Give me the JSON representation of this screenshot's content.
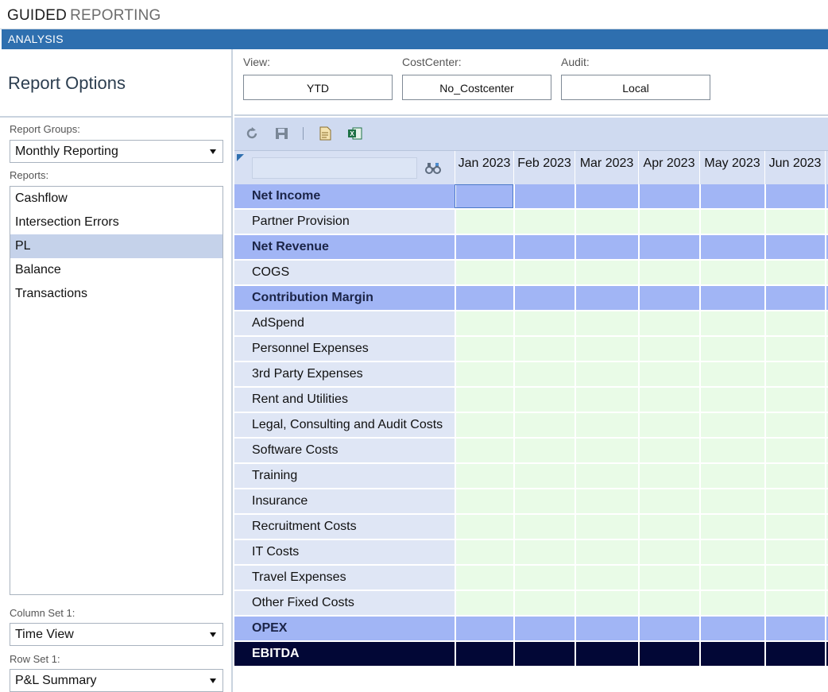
{
  "app": {
    "title_part1": "GUIDED",
    "title_part2": "REPORTING"
  },
  "nav": {
    "section": "ANALYSIS"
  },
  "left": {
    "heading": "Report Options",
    "report_groups_label": "Report Groups:",
    "report_group_value": "Monthly Reporting",
    "reports_label": "Reports:",
    "reports": [
      {
        "label": "Cashflow",
        "selected": false
      },
      {
        "label": "Intersection Errors",
        "selected": false
      },
      {
        "label": "PL",
        "selected": true
      },
      {
        "label": "Balance",
        "selected": false
      },
      {
        "label": "Transactions",
        "selected": false
      }
    ],
    "column_set_label": "Column Set 1:",
    "column_set_value": "Time View",
    "row_set_label": "Row Set 1:",
    "row_set_value": "P&L Summary"
  },
  "options": {
    "view_label": "View:",
    "view_value": "YTD",
    "costcenter_label": "CostCenter:",
    "costcenter_value": "No_Costcenter",
    "audit_label": "Audit:",
    "audit_value": "Local"
  },
  "toolbar": {
    "icons": [
      "refresh-icon",
      "save-icon",
      "document-icon",
      "excel-icon"
    ]
  },
  "grid": {
    "filter_placeholder": "",
    "columns": [
      "Jan 2023",
      "Feb 2023",
      "Mar 2023",
      "Apr 2023",
      "May 2023",
      "Jun 2023"
    ],
    "rows": [
      {
        "label": "Net Income",
        "type": "header"
      },
      {
        "label": "Partner Provision",
        "type": "detail"
      },
      {
        "label": "Net Revenue",
        "type": "header"
      },
      {
        "label": "COGS",
        "type": "detail"
      },
      {
        "label": "Contribution Margin",
        "type": "header"
      },
      {
        "label": "AdSpend",
        "type": "detail"
      },
      {
        "label": "Personnel Expenses",
        "type": "detail"
      },
      {
        "label": "3rd Party Expenses",
        "type": "detail"
      },
      {
        "label": "Rent and Utilities",
        "type": "detail"
      },
      {
        "label": "Legal, Consulting and Audit Costs",
        "type": "detail"
      },
      {
        "label": "Software Costs",
        "type": "detail"
      },
      {
        "label": "Training",
        "type": "detail"
      },
      {
        "label": "Insurance",
        "type": "detail"
      },
      {
        "label": "Recruitment Costs",
        "type": "detail"
      },
      {
        "label": "IT Costs",
        "type": "detail"
      },
      {
        "label": "Travel Expenses",
        "type": "detail"
      },
      {
        "label": "Other Fixed Costs",
        "type": "detail"
      },
      {
        "label": "OPEX",
        "type": "header"
      },
      {
        "label": "EBITDA",
        "type": "dark"
      }
    ],
    "colors": {
      "header_row": "#a1b5f5",
      "detail_row": "#dfe6f5",
      "detail_cell": "#e9fbe7",
      "total_row": "#020736"
    }
  }
}
